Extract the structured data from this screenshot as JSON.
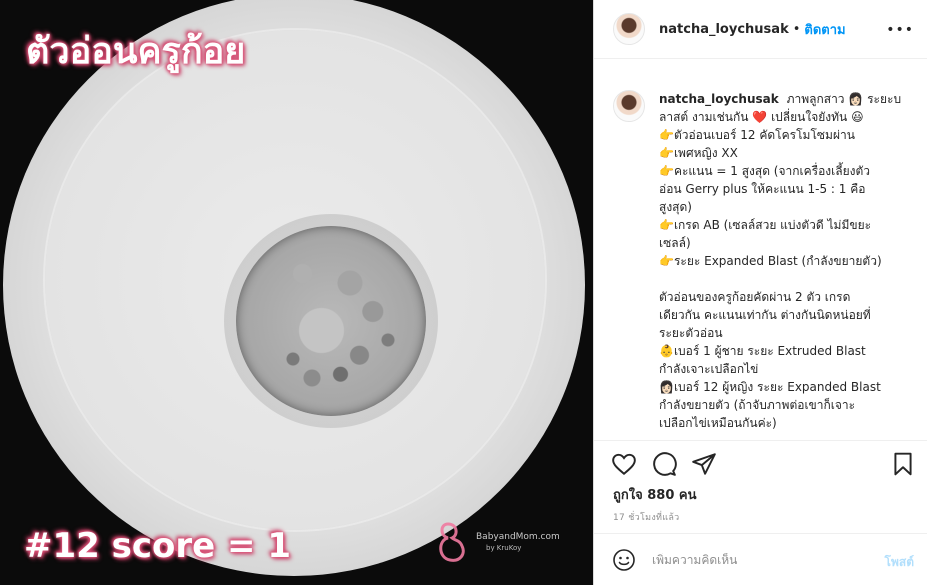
{
  "media": {
    "overlay_title": "ตัวอ่อนครูก้อย",
    "overlay_score": "#12 score = 1",
    "watermark_brand": "BabyandMom.com",
    "watermark_sub": "by KruKoy"
  },
  "header": {
    "username": "natcha_loychusak",
    "dot": "•",
    "follow_label": "ติดตาม",
    "more_label": "•••"
  },
  "caption": {
    "username": "natcha_loychusak",
    "lines": [
      "ภาพลูกสาว 👩🏻 ระยะบ",
      "ลาสต์ งามเช่นกัน",
      "เปลี่ยนใจยังทัน 😃",
      "👉ตัวอ่อนเบอร์ 12 คัดโครโมโซมผ่าน",
      "👉เพศหญิง XX",
      "👉คะแนน = 1 สูงสุด (จากเครื่องเลี้ยงตัว",
      "อ่อน Gerry plus ให้คะแนน 1-5 : 1 คือ",
      "สูงสุด)",
      "👉เกรด AB (เซลล์สวย แบ่งตัวดี ไม่มีขยะ",
      "เซลล์)",
      "👉ระยะ Expanded Blast (กำลังขยายตัว)",
      "",
      "ตัวอ่อนของครูก้อยคัดผ่าน 2 ตัว เกรด",
      "เดียวกัน คะแนนเท่ากัน ต่างกันนิดหน่อยที่",
      "ระยะตัวอ่อน",
      "👶เบอร์ 1 ผู้ชาย ระยะ Extruded Blast",
      "กำลังเจาะเปลือกไข่",
      "👩🏻เบอร์ 12 ผู้หญิง ระยะ Expanded Blast",
      "กำลังขยายตัว (ถ้าจับภาพต่อเขาก็เจาะ",
      "เปลือกไข่เหมือนกันค่ะ)"
    ],
    "heart": "❤️"
  },
  "likes": "ถูกใจ 880 คน",
  "time_ago": "17 ชั่วโมงที่แล้ว",
  "comment": {
    "placeholder": "เพิ่มความคิดเห็น",
    "post_label": "โพสต์"
  },
  "colors": {
    "accent": "#0095f6",
    "post_disabled": "#b2dffc",
    "overlay_glow": "#e0567a"
  },
  "icons": {
    "like": "heart-icon",
    "comment": "comment-icon",
    "share": "paper-plane-icon",
    "save": "bookmark-icon",
    "emoji": "smiley-icon"
  }
}
